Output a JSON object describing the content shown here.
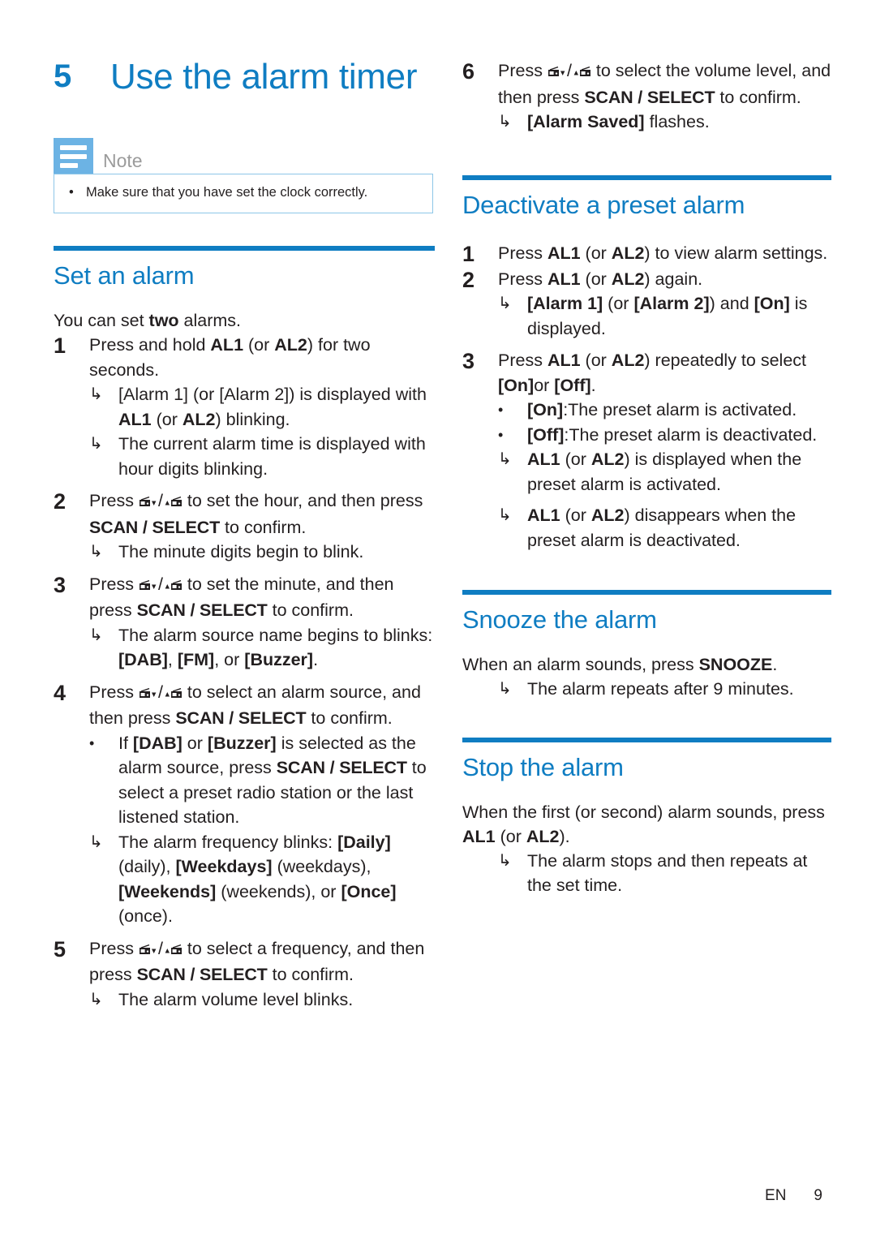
{
  "meta": {
    "accent_color": "#0f7dc2",
    "note_badge_color": "#6cb3e4",
    "note_border_color": "#8dc6e8",
    "text_color": "#231f20",
    "note_label_color": "#9b9b9b"
  },
  "chapter": {
    "number": "5",
    "title": "Use the alarm timer"
  },
  "note": {
    "label": "Note",
    "icon": "note-lines-icon",
    "bullets": [
      "Make sure that you have set the clock correctly."
    ]
  },
  "sections": [
    {
      "id": "set-an-alarm",
      "title": "Set an alarm",
      "intro_pre": "You can set ",
      "intro_bold": "two",
      "intro_post": " alarms.",
      "steps": [
        {
          "number": "1",
          "text_parts": [
            "Press and hold ",
            "AL1",
            " (or ",
            "AL2",
            ") for two seconds."
          ],
          "subs": [
            {
              "mark": "arrow",
              "text": "[Alarm 1] (or [Alarm 2]) is displayed with AL1 (or AL2) blinking."
            },
            {
              "mark": "arrow",
              "text": "The current alarm time is displayed with hour digits blinking."
            }
          ]
        },
        {
          "number": "2",
          "text_before_icons": "Press ",
          "text_after_icons": " to set the hour, and then press ",
          "button": "SCAN / SELECT",
          "text_tail": " to confirm.",
          "subs": [
            {
              "mark": "arrow",
              "text": "The minute digits begin to blink."
            }
          ]
        },
        {
          "number": "3",
          "text_before_icons": "Press ",
          "text_after_icons": " to set the minute, and then press ",
          "button": "SCAN / SELECT",
          "text_tail": " to confirm.",
          "subs": [
            {
              "mark": "arrow",
              "text": "The alarm source name begins to blinks: [DAB], [FM], or [Buzzer]."
            }
          ]
        },
        {
          "number": "4",
          "text_before_icons": "Press ",
          "text_after_icons": " to select an alarm source, and then press ",
          "button": "SCAN / SELECT",
          "text_tail": " to confirm.",
          "subs": [
            {
              "mark": "dot",
              "text": "If [DAB] or [Buzzer] is selected as the alarm source, press SCAN / SELECT to select a preset radio station or the last listened station."
            },
            {
              "mark": "arrow",
              "text": "The alarm frequency blinks: [Daily] (daily), [Weekdays] (weekdays), [Weekends] (weekends), or [Once](once)."
            }
          ]
        },
        {
          "number": "5",
          "text_before_icons": "Press ",
          "text_after_icons": " to select a frequency, and then press ",
          "button": "SCAN / SELECT",
          "text_tail": " to confirm.",
          "subs": [
            {
              "mark": "arrow",
              "text": "The alarm volume level blinks."
            }
          ]
        },
        {
          "number": "6",
          "text_before_icons": "Press ",
          "text_after_icons": " to select the volume level, and then press ",
          "button": "SCAN / SELECT",
          "text_tail": " to confirm.",
          "subs": [
            {
              "mark": "arrow",
              "text": "[Alarm Saved] flashes."
            }
          ]
        }
      ]
    },
    {
      "id": "deactivate-a-preset-alarm",
      "title": "Deactivate a preset alarm",
      "steps": [
        {
          "number": "1",
          "text": "Press AL1 (or AL2) to view alarm settings."
        },
        {
          "number": "2",
          "text": "Press AL1 (or AL2) again.",
          "subs": [
            {
              "mark": "arrow",
              "text": "[Alarm 1] (or [Alarm 2]) and [On] is displayed."
            }
          ]
        },
        {
          "number": "3",
          "text": "Press AL1 (or AL2) repeatedly to select [On]or [Off].",
          "subs": [
            {
              "mark": "dot",
              "text": "[On]:The preset alarm is activated."
            },
            {
              "mark": "dot",
              "text": "[Off]:The preset alarm is deactivated."
            },
            {
              "mark": "arrow",
              "text": "AL1 (or AL2) is displayed when the preset alarm is activated."
            },
            {
              "mark": "arrow",
              "text": "AL1 (or AL2) disappears when the preset alarm is deactivated."
            }
          ]
        }
      ]
    },
    {
      "id": "snooze-the-alarm",
      "title": "Snooze the alarm",
      "body": "When an alarm sounds, press SNOOZE.",
      "subs": [
        {
          "mark": "arrow",
          "text": "The alarm repeats after 9 minutes."
        }
      ]
    },
    {
      "id": "stop-the-alarm",
      "title": "Stop the alarm",
      "body": "When the first (or second) alarm sounds, press AL1 (or AL2).",
      "subs": [
        {
          "mark": "arrow",
          "text": "The alarm stops and then repeats at the set time."
        }
      ]
    }
  ],
  "footer": {
    "language": "EN",
    "page_number": "9"
  }
}
